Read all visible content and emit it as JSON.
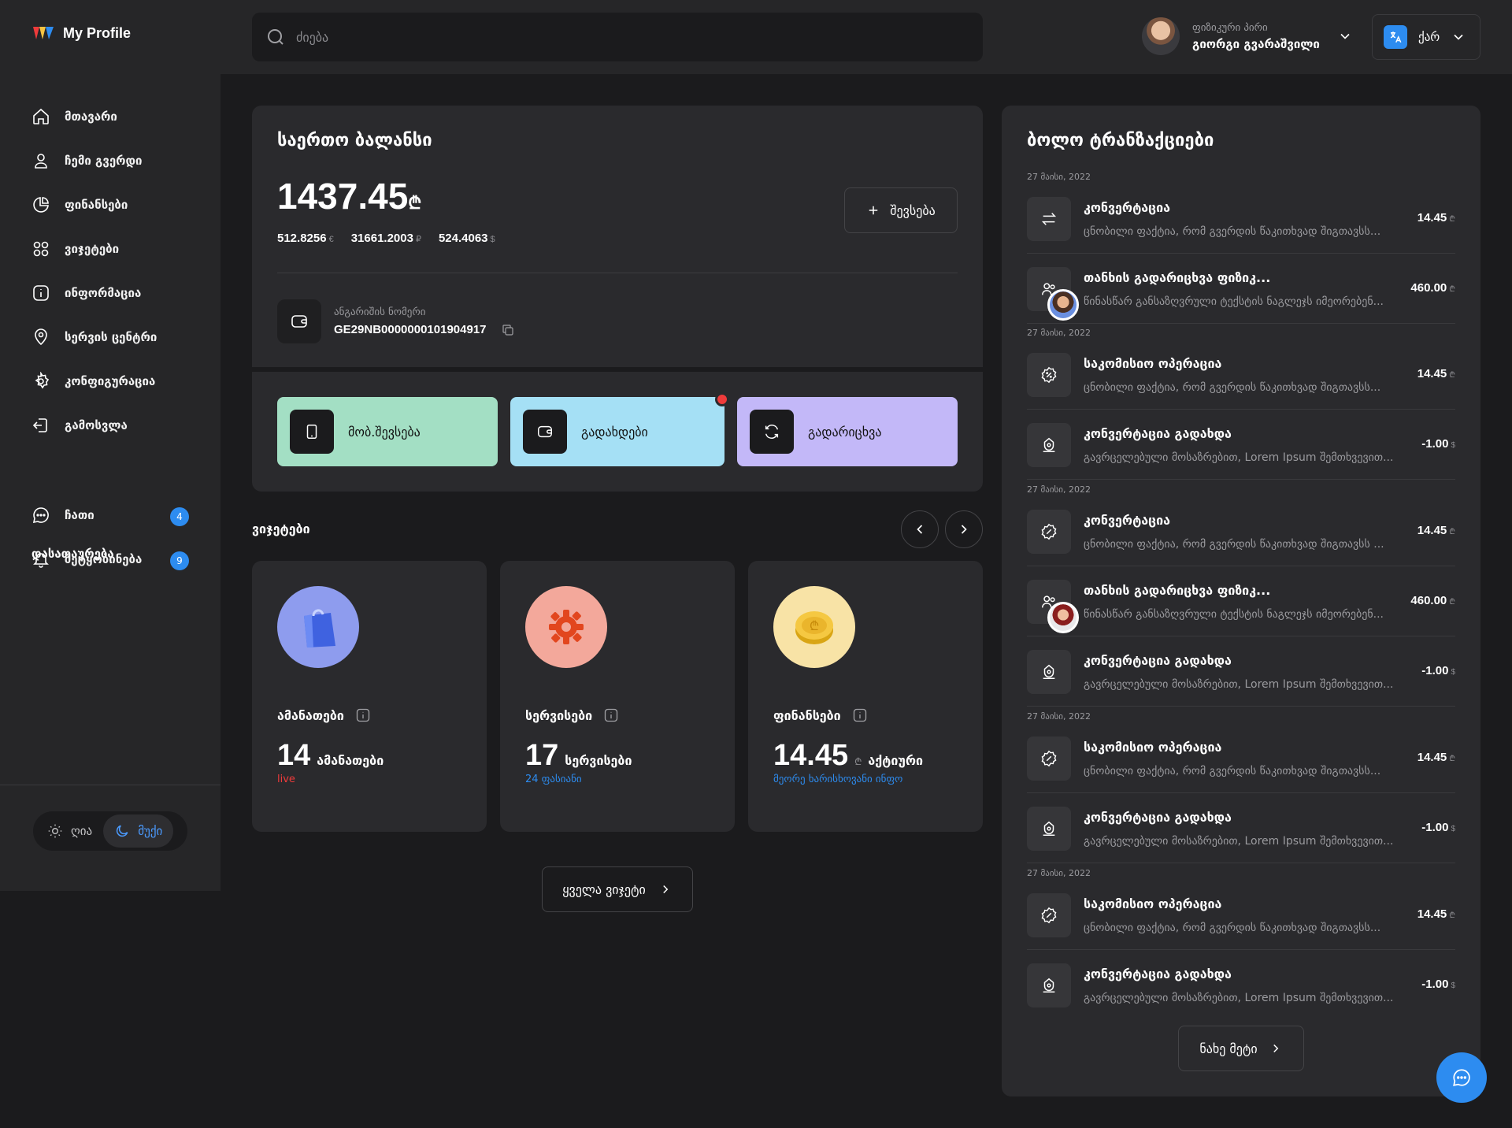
{
  "header": {
    "logo_text": "My Profile",
    "search_placeholder": "ძიება",
    "profile_role": "ფიზიკური პირი",
    "profile_name": "გიორგი გვარაშვილი",
    "language": "ქარ"
  },
  "sidebar": {
    "items": [
      {
        "label": "მთავარი",
        "icon": "home-icon"
      },
      {
        "label": "ჩემი გვერდი",
        "icon": "user-icon"
      },
      {
        "label": "ფინანსები",
        "icon": "pie-chart-icon"
      },
      {
        "label": "ვიჯეტები",
        "icon": "grid-icon"
      },
      {
        "label": "ინფორმაცია",
        "icon": "info-icon"
      },
      {
        "label": "სერვის ცენტრი",
        "icon": "location-icon"
      },
      {
        "label": "კონფიგურაცია",
        "icon": "gear-icon"
      },
      {
        "label": "გამოსვლა",
        "icon": "logout-icon"
      }
    ],
    "support_title": "დასათაურება",
    "support_items": [
      {
        "label": "ჩათი",
        "icon": "chat-icon",
        "badge": "4"
      },
      {
        "label": "შეტყობინება",
        "icon": "bell-icon",
        "badge": "9"
      }
    ],
    "theme": {
      "light": "ღია",
      "dark": "მუქი",
      "active": "dark"
    }
  },
  "balance": {
    "title": "საერთო ბალანსი",
    "amount": "1437.45",
    "currency": "₾",
    "sub": [
      {
        "value": "512.8256",
        "currency": "€"
      },
      {
        "value": "31661.2003",
        "currency": "₽"
      },
      {
        "value": "524.4063",
        "currency": "$"
      }
    ],
    "topup_label": "შევსება",
    "account_label": "ანგარიშის ნომერი",
    "account_number": "GE29NB0000000101904917",
    "actions": [
      {
        "label": "მობ.შევსება",
        "color": "#a3dfc4",
        "icon": "phone-icon"
      },
      {
        "label": "გადახდები",
        "color": "#a5e0f5",
        "icon": "wallet-icon",
        "notification": true
      },
      {
        "label": "გადარიცხვა",
        "color": "#c3b8f8",
        "icon": "transfer-icon"
      }
    ]
  },
  "packages": {
    "title": "ვიჯეტები",
    "cards": [
      {
        "name": "ამანათები",
        "count": "14",
        "unit": "ამანათები",
        "note": "live",
        "note_color": "#ef3b3b",
        "bg": "#8e9cee",
        "icon": "shopping-bag-icon"
      },
      {
        "name": "სერვისები",
        "count": "17",
        "unit": "სერვისები",
        "note": "24 ფასიანი",
        "note_color": "#2d8cf0",
        "bg": "#f3a89b",
        "icon": "gear-3d-icon"
      },
      {
        "name": "ფინანსები",
        "count": "14.45",
        "currency": "₾",
        "unit": "აქტიური",
        "note": "მეორე ხარისხოვანი ინფო",
        "note_color": "#2d8cf0",
        "bg": "#f8e3a6",
        "icon": "coin-icon"
      }
    ],
    "all_label": "ყველა ვიჯეტი"
  },
  "transactions": {
    "title": "ბოლო ტრანზაქციები",
    "dates": [
      "27 მაისი, 2022",
      "27 მაისი, 2022",
      "27 მაისი, 2022",
      "27 მაისი, 2022",
      "27 მაისი, 2022"
    ],
    "items": [
      {
        "name": "კონვერტაცია",
        "desc": "ცნობილი ფაქტია, რომ გვერდის წაკითხვად შიგთავსს...",
        "amount": "14.45",
        "currency": "₾",
        "icon": "exchange-icon"
      },
      {
        "name": "თანხის გადარიცხვა ფიზიკ...",
        "desc": "წინასწარ განსაზღვრული ტექსტის ნაგლეჯს იმეორებენ...",
        "amount": "460.00",
        "currency": "₾",
        "icon": "users-icon",
        "avatar": "man"
      },
      {
        "name": "საკომისიო ოპერაცია",
        "desc": "ცნობილი ფაქტია, რომ გვერდის წაკითხვად შიგთავსს...",
        "amount": "14.45",
        "currency": "₾",
        "icon": "percent-icon"
      },
      {
        "name": "კონვერტაცია გადახდა",
        "desc": "გავრცელებული მოსაზრებით, Lorem Ipsum შემთხვევით...",
        "amount": "-1.00",
        "currency": "$",
        "icon": "payment-icon"
      },
      {
        "name": "კონვერტაცია",
        "desc": "ცნობილი ფაქტია, რომ გვერდის წაკითხვად შიგთავსს ...",
        "amount": "14.45",
        "currency": "₾",
        "icon": "percent-icon"
      },
      {
        "name": "თანხის გადარიცხვა ფიზიკ...",
        "desc": "წინასწარ განსაზღვრული ტექსტის ნაგლეჯს იმეორებენ...",
        "amount": "460.00",
        "currency": "₾",
        "icon": "users-icon",
        "avatar": "woman"
      },
      {
        "name": "კონვერტაცია გადახდა",
        "desc": "გავრცელებული მოსაზრებით, Lorem Ipsum შემთხვევით...",
        "amount": "-1.00",
        "currency": "$",
        "icon": "payment-icon"
      },
      {
        "name": "საკომისიო ოპერაცია",
        "desc": "ცნობილი ფაქტია, რომ გვერდის წაკითხვად შიგთავსს...",
        "amount": "14.45",
        "currency": "₾",
        "icon": "percent-icon"
      },
      {
        "name": "კონვერტაცია გადახდა",
        "desc": "გავრცელებული მოსაზრებით, Lorem Ipsum შემთხვევით...",
        "amount": "-1.00",
        "currency": "$",
        "icon": "payment-icon"
      },
      {
        "name": "საკომისიო ოპერაცია",
        "desc": "ცნობილი ფაქტია, რომ გვერდის წაკითხვად შიგთავსს...",
        "amount": "14.45",
        "currency": "₾",
        "icon": "percent-icon"
      },
      {
        "name": "კონვერტაცია გადახდა",
        "desc": "გავრცელებული მოსაზრებით, Lorem Ipsum შემთხვევით...",
        "amount": "-1.00",
        "currency": "$",
        "icon": "payment-icon"
      }
    ],
    "more_label": "ნახე მეტი"
  }
}
